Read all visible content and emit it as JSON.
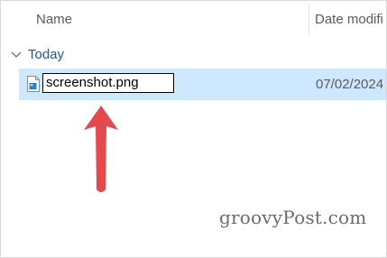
{
  "columns": {
    "name": "Name",
    "date_modified": "Date modifi"
  },
  "group": {
    "label": "Today",
    "icon": "chevron-down-icon"
  },
  "file": {
    "icon": "image-file-icon",
    "rename_value": "screenshot.png",
    "date": "07/02/2024"
  },
  "annotation": {
    "icon": "arrow-up-icon",
    "color": "#e5484d"
  },
  "watermark": "groovyPost.com",
  "colors": {
    "selection": "#cde8ff",
    "group_label": "#1a56a8"
  }
}
